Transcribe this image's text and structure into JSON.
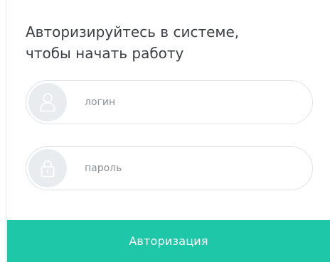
{
  "login_form": {
    "title_line1": "Авторизируйтесь в системе,",
    "title_line2": "чтобы начать работу",
    "login": {
      "placeholder": "логин",
      "value": "",
      "icon": "user-icon"
    },
    "password": {
      "placeholder": "пароль",
      "value": "",
      "icon": "lock-icon"
    },
    "submit_label": "Авторизация"
  },
  "colors": {
    "accent": "#1ec7a8",
    "title_text": "#3c3f43",
    "placeholder_text": "#8d9296",
    "field_border": "#dfe3e6",
    "icon_circle": "#e9ecee"
  }
}
